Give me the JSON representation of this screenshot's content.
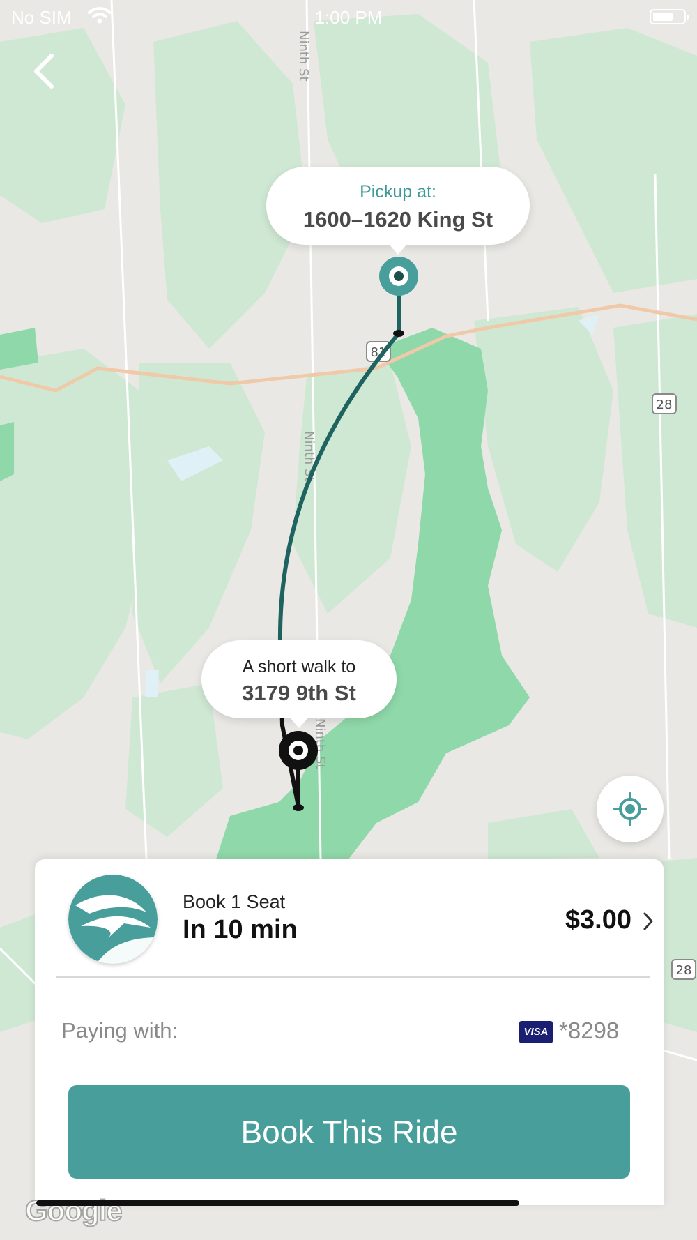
{
  "status_bar": {
    "carrier": "No SIM",
    "time": "1:00 PM"
  },
  "map": {
    "street_labels": [
      "Ninth St",
      "Ninth St",
      "Ninth St"
    ],
    "route_shields": [
      "81",
      "28",
      "28"
    ],
    "attribution": "Google",
    "colors": {
      "land": "#e9e8e4",
      "park": "#cfe8d3",
      "park_dark": "#8fd8a9",
      "route": "#1f6360",
      "highway": "#f0c9a8"
    }
  },
  "pickup_callout": {
    "label": "Pickup at:",
    "address": "1600–1620 King St"
  },
  "walk_callout": {
    "label": "A short walk to",
    "address": "3179 9th St"
  },
  "ride": {
    "seat_label": "Book 1 Seat",
    "eta": "In 10 min",
    "price": "$3.00"
  },
  "payment": {
    "label": "Paying with:",
    "card_brand": "VISA",
    "card_number": "*8298"
  },
  "book_button": {
    "label": "Book This Ride",
    "color": "#479e9b"
  },
  "icons": [
    "back-icon",
    "wifi-icon",
    "battery-icon",
    "locate-icon",
    "chevron-right-icon",
    "visa-icon"
  ]
}
